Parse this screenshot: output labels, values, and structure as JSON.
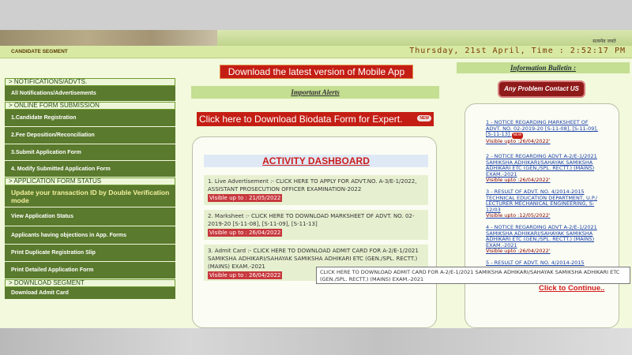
{
  "header": {
    "logo_text": "सत्यमेव जयते",
    "segment_label": "CANDIDATE SEGMENT",
    "datetime": "Thursday, 21st April, Time : 2:52:17 PM"
  },
  "center": {
    "download_app_label": "Download the latest version of Mobile App",
    "important_alerts": "Important Alerts",
    "biodata_label": "Click here to Download Biodata Form for Expert.",
    "new_badge": "NEW",
    "dashboard_title": "ACTIVITY DASHBOARD",
    "activities": [
      {
        "text": "1. Live Advertisement :- CLICK HERE TO APPLY FOR ADVT.NO. A-3/E-1/2022, ASSISTANT PROSECUTION OFFICER EXAMINATION-2022",
        "visible": "Visible up to : 21/05/2022"
      },
      {
        "text": "2. Marksheet :- CLICK HERE TO DOWNLOAD MARKSHEET OF ADVT. NO. 02-2019-20 [S-11-08], [S-11-09], [S-11-13]",
        "visible": "Visible up to : 26/04/2022"
      },
      {
        "text": "3. Admit Card :- CLICK HERE TO DOWNLOAD ADMIT CARD FOR A-2/E-1/2021 SAMIKSHA ADHIKARI/SAHAYAK SAMIKSHA ADHIKARI ETC (GEN./SPL. RECTT.) (MAINS) EXAM.-2021",
        "visible": "Visible up to : 26/04/2022"
      }
    ]
  },
  "sidebar": {
    "sections": [
      {
        "heading": "> NOTIFICATIONS/ADVTS.",
        "items": [
          "All Notifications/Advertisements"
        ]
      },
      {
        "heading": "> ONLINE FORM SUBMISSION",
        "items": [
          "1.Candidate Registration",
          "2.Fee Deposition/Reconciliation",
          "3.Submit Application Form",
          "4. Modify Submitted Application Form"
        ]
      },
      {
        "heading": "> APPLICATION FORM STATUS",
        "items": [
          "Update your transaction ID by Double Verification mode",
          "View Application Status",
          "Applicants having objections in App. Forms",
          "Print Duplicate Registration Slip",
          "Print Detailed Application Form"
        ]
      },
      {
        "heading": "> DOWNLOAD SEGMENT",
        "items": [
          "Download Admit Card"
        ]
      }
    ]
  },
  "right": {
    "info_title": "Information Bulletin :",
    "contact_label": "Any Problem Contact US",
    "bulletins": [
      {
        "text": "1 - NOTICE REGARDING MARKSHEET OF ADVT. NO. 02-2019-20 [S-11-08], [S-11-09], [S-11-13]",
        "visible": "Visible upto :26/04/2022'",
        "new": "NEW"
      },
      {
        "text": "2 - NOTICE REGARDING ADVT A-2/E-1/2021 SAMIKSHA ADHIKARI/SAHAYAK SAMIKSHA ADHIKARI ETC (GEN./SPL. RECTT.) (MAINS) EXAM.-2021",
        "visible": "Visible upto :26/04/2022'"
      },
      {
        "text": "3 - RESULT OF ADVT. NO. 4/2014-2015 TECHNICAL EDUCATION DEPARTMENT, U.P./ LECTURER MECHANICAL ENGINEERING, S-12/03",
        "visible": "Visible upto :12/05/2022'"
      },
      {
        "text": "4 - NOTICE REGARDING ADVT A-2/E-1/2021 SAMIKSHA ADHIKARI/SAHAYAK SAMIKSHA ADHIKARI ETC (GEN./SPL. RECTT.) (MAINS) EXAM.-2021",
        "visible": "Visible upto :26/04/2022'"
      },
      {
        "text": "5 - RESULT OF ADVT. NO. 4/2014-2015",
        "visible": ""
      }
    ],
    "continue_label": "Click to Continue.."
  },
  "tooltip": {
    "text": "CLICK HERE TO DOWNLOAD ADMIT CARD FOR A-2/E-1/2021 SAMIKSHA ADHIKARI/SAHAYAK SAMIKSHA ADHIKARI ETC (GEN./SPL. RECTT.) (MAINS) EXAM.-2021"
  },
  "colors": {
    "accent_red": "#c41e14",
    "sidebar_green": "#5a7a2d",
    "page_bg": "#f2f9dc"
  }
}
